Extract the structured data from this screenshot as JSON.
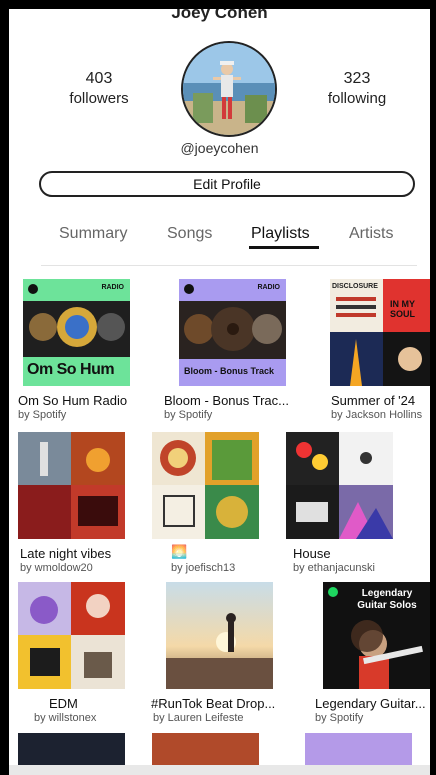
{
  "profile": {
    "name": "Joey Cohen",
    "followers_count": "403",
    "followers_label": "followers",
    "following_count": "323",
    "following_label": "following",
    "handle": "@joeycohen",
    "edit_label": "Edit Profile"
  },
  "tabs": [
    {
      "label": "Summary",
      "active": false
    },
    {
      "label": "Songs",
      "active": false
    },
    {
      "label": "Playlists",
      "active": true
    },
    {
      "label": "Artists",
      "active": false
    }
  ],
  "playlists": [
    {
      "title": "Om So Hum Radio",
      "by": "by Spotify",
      "cover_badge": "RADIO",
      "cover_text": "Om So Hum"
    },
    {
      "title": "Bloom - Bonus Trac...",
      "by": "by Spotify",
      "cover_badge": "RADIO",
      "cover_text": "Bloom - Bonus Track"
    },
    {
      "title": "Summer of '24",
      "by": "by Jackson Hollins",
      "cover_text_1": "DISCLOSURE",
      "cover_text_2": "IN MY SOUL"
    },
    {
      "title": "Late night vibes",
      "by": "by wmoldow20"
    },
    {
      "title": "🌅",
      "by": "by joefisch13"
    },
    {
      "title": "House",
      "by": "by ethanjacunski"
    },
    {
      "title": "EDM",
      "by": "by willstonex"
    },
    {
      "title": "#RunTok Beat Drop...",
      "by": "by Lauren Leifeste"
    },
    {
      "title": "Legendary Guitar...",
      "by": "by Spotify",
      "cover_text": "Legendary Guitar Solos"
    }
  ]
}
